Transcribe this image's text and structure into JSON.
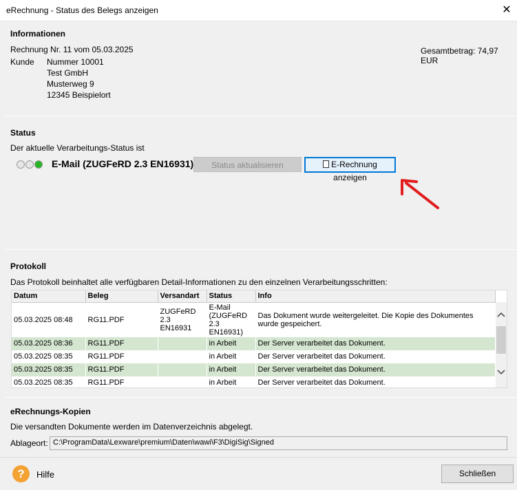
{
  "window": {
    "title": "eRechnung - Status des Belegs anzeigen",
    "close_glyph": "✕"
  },
  "info": {
    "heading": "Informationen",
    "invoice_line": "Rechnung Nr. 11 vom 05.03.2025",
    "total": "Gesamtbetrag: 74,97 EUR",
    "customer_label": "Kunde",
    "customer_lines": [
      "Nummer  10001",
      "Test GmbH",
      "Musterweg 9",
      "12345 Beispielort"
    ]
  },
  "status": {
    "heading": "Status",
    "description": "Der aktuelle Verarbeitungs-Status ist",
    "dots": [
      "#e6e6e6",
      "#e6e6e6",
      "#27b427"
    ],
    "value": "E-Mail (ZUGFeRD 2.3 EN16931)",
    "refresh_label": "Status aktualisieren",
    "show_label": "E-Rechnung anzeigen",
    "arrow_color": "#e11d1d"
  },
  "protocol": {
    "heading": "Protokoll",
    "description": "Das Protokoll beinhaltet alle verfügbaren Detail-Informationen zu den einzelnen Verarbeitungsschritten:",
    "columns": [
      "Datum",
      "Beleg",
      "Versandart",
      "Status",
      "Info"
    ],
    "rows": [
      {
        "date": "05.03.2025 08:48",
        "doc": "RG11.PDF",
        "method": "ZUGFeRD 2.3 EN16931",
        "status": "E-Mail (ZUGFeRD 2.3 EN16931)",
        "info": "Das Dokument wurde weitergeleitet. Die Kopie des Dokumentes wurde gespeichert."
      },
      {
        "date": "05.03.2025 08:36",
        "doc": "RG11.PDF",
        "method": "",
        "status": "in Arbeit",
        "info": "Der Server verarbeitet das Dokument."
      },
      {
        "date": "05.03.2025 08:35",
        "doc": "RG11.PDF",
        "method": "",
        "status": "in Arbeit",
        "info": "Der Server verarbeitet das Dokument."
      },
      {
        "date": "05.03.2025 08:35",
        "doc": "RG11.PDF",
        "method": "",
        "status": "in Arbeit",
        "info": "Der Server verarbeitet das Dokument."
      },
      {
        "date": "05.03.2025 08:35",
        "doc": "RG11.PDF",
        "method": "",
        "status": "in Arbeit",
        "info": "Der Server verarbeitet das Dokument."
      }
    ],
    "highlight_color": "#d4e6cf"
  },
  "copies": {
    "heading": "eRechnungs-Kopien",
    "description": "Die versandten Dokumente werden im Datenverzeichnis abgelegt.",
    "path_label": "Ablageort:",
    "path_value": "C:\\ProgramData\\Lexware\\premium\\Daten\\wawi\\F3\\DigiSig\\Signed"
  },
  "footer": {
    "help_glyph": "?",
    "help_label": "Hilfe",
    "close_label": "Schließen"
  }
}
